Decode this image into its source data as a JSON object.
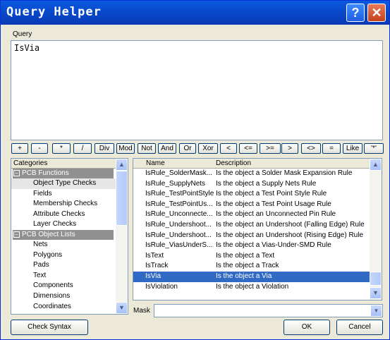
{
  "window": {
    "title": "Query Helper",
    "help_label": "?",
    "close_label": "✕"
  },
  "query": {
    "label": "Query",
    "text": "IsVia"
  },
  "operators": [
    "+",
    "-",
    "*",
    "/",
    "Div",
    "Mod",
    "Not",
    "And",
    "Or",
    "Xor",
    "<",
    "<=",
    ">=",
    ">",
    "<>",
    "=",
    "Like",
    "'*'"
  ],
  "categories": {
    "header": "Categories",
    "groups": [
      {
        "label": "PCB Functions",
        "items": [
          "Object Type Checks",
          "Fields",
          "Membership Checks",
          "Attribute Checks",
          "Layer Checks"
        ]
      },
      {
        "label": "PCB Object Lists",
        "items": [
          "Nets",
          "Polygons",
          "Pads",
          "Text",
          "Components",
          "Dimensions",
          "Coordinates"
        ]
      }
    ],
    "selected_item": "Object Type Checks",
    "scroll_up_icon": "▲",
    "scroll_down_icon": "▼"
  },
  "functions": {
    "headers": {
      "name": "Name",
      "description": "Description"
    },
    "rows": [
      {
        "name": "IsRule_SolderMask...",
        "description": "Is the object a Solder Mask Expansion Rule"
      },
      {
        "name": "IsRule_SupplyNets",
        "description": "Is the object a Supply Nets Rule"
      },
      {
        "name": "IsRule_TestPointStyle",
        "description": "Is the object a Test Point Style Rule"
      },
      {
        "name": "IsRule_TestPointUs...",
        "description": "Is the object a Test Point Usage Rule"
      },
      {
        "name": "IsRule_Unconnecte...",
        "description": "Is the object an Unconnected Pin Rule"
      },
      {
        "name": "IsRule_Undershoot...",
        "description": "Is the object an Undershoot (Falling Edge) Rule"
      },
      {
        "name": "IsRule_Undershoot...",
        "description": "Is the object an Undershoot (Rising Edge) Rule"
      },
      {
        "name": "IsRule_ViasUnderS...",
        "description": "Is the object a Vias-Under-SMD Rule"
      },
      {
        "name": "IsText",
        "description": "Is the object a Text"
      },
      {
        "name": "IsTrack",
        "description": "Is the object a Track"
      },
      {
        "name": "IsVia",
        "description": "Is the object a Via"
      },
      {
        "name": "IsViolation",
        "description": "Is the object a Violation"
      }
    ],
    "selected_name": "IsVia"
  },
  "mask": {
    "label": "Mask",
    "value": "",
    "dropdown_icon": "▼"
  },
  "buttons": {
    "check_syntax": "Check Syntax",
    "ok": "OK",
    "cancel": "Cancel"
  }
}
